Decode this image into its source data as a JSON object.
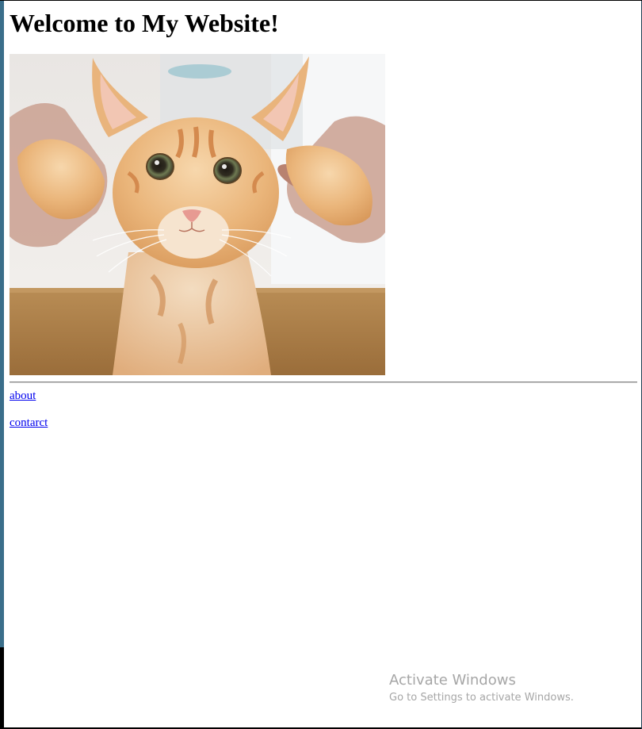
{
  "page": {
    "heading": "Welcome to My Website!",
    "image": {
      "subject": "orange tabby kitten held up by hands",
      "alt": ""
    },
    "links": [
      {
        "label": "about"
      },
      {
        "label": "contarct"
      }
    ]
  },
  "os_overlay": {
    "title": "Activate Windows",
    "subtitle": "Go to Settings to activate Windows."
  },
  "colors": {
    "link": "#0000ee",
    "heading": "#000000",
    "left_strip": "#3a6e8a",
    "watermark": "#a6a6a6"
  }
}
